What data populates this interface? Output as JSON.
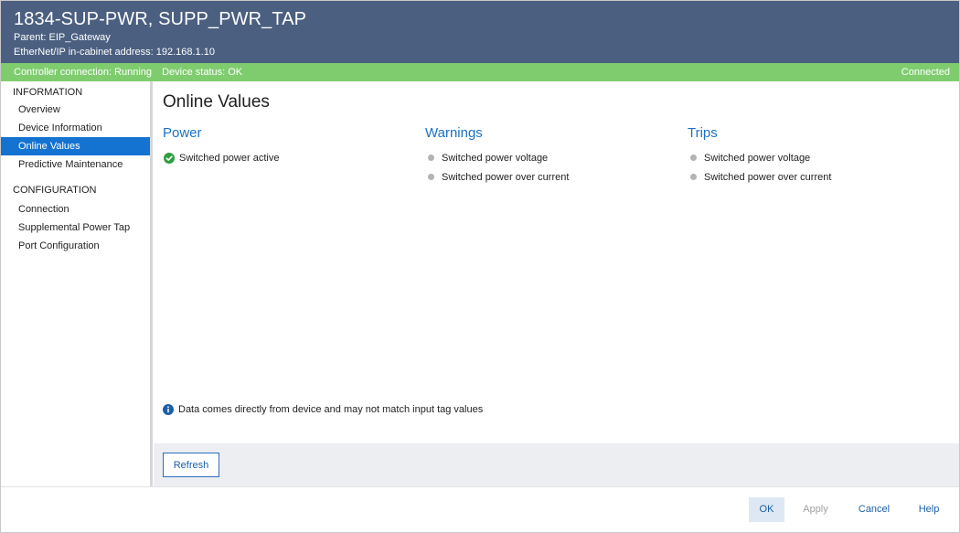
{
  "header": {
    "title": "1834-SUP-PWR, SUPP_PWR_TAP",
    "parent_line": "Parent:  EIP_Gateway",
    "address_line": "EtherNet/IP in-cabinet address:  192.168.1.10"
  },
  "status": {
    "controller": "Controller connection: Running",
    "device": "Device status: OK",
    "connection": "Connected"
  },
  "sidebar": {
    "info_heading": "INFORMATION",
    "info_items": [
      {
        "label": "Overview"
      },
      {
        "label": "Device Information"
      },
      {
        "label": "Online Values",
        "active": true
      },
      {
        "label": "Predictive Maintenance"
      }
    ],
    "config_heading": "CONFIGURATION",
    "config_items": [
      {
        "label": "Connection"
      },
      {
        "label": "Supplemental Power Tap"
      },
      {
        "label": "Port Configuration"
      }
    ]
  },
  "main": {
    "title": "Online Values",
    "power": {
      "heading": "Power",
      "items": [
        {
          "label": "Switched power active",
          "icon": "check-circle-icon",
          "state": "active"
        }
      ]
    },
    "warnings": {
      "heading": "Warnings",
      "items": [
        {
          "label": "Switched power voltage",
          "state": "inactive"
        },
        {
          "label": "Switched power over current",
          "state": "inactive"
        }
      ]
    },
    "trips": {
      "heading": "Trips",
      "items": [
        {
          "label": "Switched power voltage",
          "state": "inactive"
        },
        {
          "label": "Switched power over current",
          "state": "inactive"
        }
      ]
    },
    "note": "Data comes directly from device and may not match input tag values"
  },
  "actions": {
    "refresh": "Refresh"
  },
  "footer": {
    "ok": "OK",
    "apply": "Apply",
    "cancel": "Cancel",
    "help": "Help"
  },
  "colors": {
    "header_bg": "#4b5f80",
    "status_bg": "#7fcc6f",
    "accent": "#1473d1",
    "heading_blue": "#1b72c4",
    "inactive_dot": "#b3b3b3",
    "ok_green": "#2e9e3f"
  }
}
